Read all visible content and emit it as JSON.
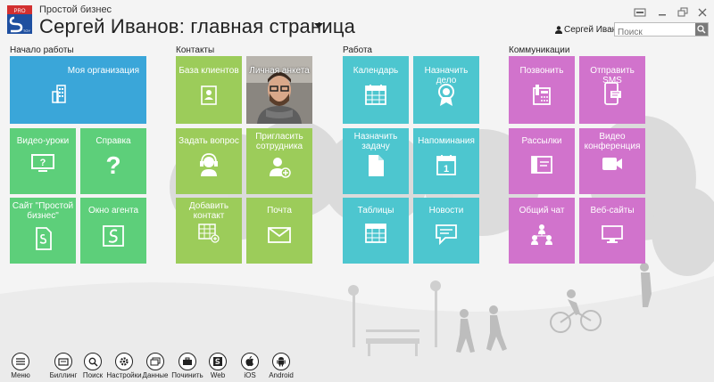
{
  "header": {
    "app_name": "Простой бизнес",
    "page_title": "Сергей Иванов: главная страница",
    "user_name": "Сергей Иванов",
    "search_placeholder": "Поиск",
    "logo_text_top": "PRO",
    "logo_text_bottom": "TOY"
  },
  "sections": {
    "start": "Начало работы",
    "contacts": "Контакты",
    "work": "Работа",
    "comms": "Коммуникации"
  },
  "tiles": {
    "my_org": "Моя организация",
    "video_lessons": "Видео-уроки",
    "help": "Справка",
    "site": "Сайт \"Простой бизнес\"",
    "agent_window": "Окно агента",
    "client_base": "База клиентов",
    "profile": "Личная анкета",
    "ask_question": "Задать вопрос",
    "invite": "Пригласить сотрудника",
    "add_contact": "Добавить контакт",
    "mail": "Почта",
    "calendar": "Календарь",
    "assign_task": "Назначить дело",
    "assign_job": "Назначить задачу",
    "reminders": "Напоминания",
    "tables": "Таблицы",
    "news": "Новости",
    "call": "Позвонить",
    "send_sms": "Отправить SMS",
    "mailings": "Рассылки",
    "video_conf": "Видео конференция",
    "chat": "Общий чат",
    "websites": "Веб-сайты"
  },
  "bottom": [
    {
      "label": "Меню"
    },
    {
      "label": "Биллинг"
    },
    {
      "label": "Поиск"
    },
    {
      "label": "Настройки"
    },
    {
      "label": "Данные"
    },
    {
      "label": "Починить"
    },
    {
      "label": "Web"
    },
    {
      "label": "iOS"
    },
    {
      "label": "Android"
    }
  ],
  "calendar_day": "1",
  "colors": {
    "blue": "#3aa6d9",
    "green": "#5dcf7a",
    "lime": "#9ccc5a",
    "teal": "#4dc6cf",
    "pink": "#d173cc"
  }
}
